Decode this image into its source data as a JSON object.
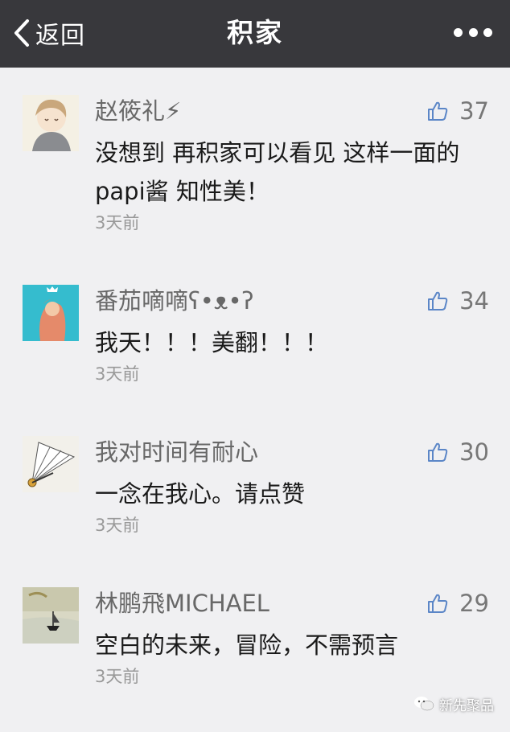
{
  "navbar": {
    "back_label": "返回",
    "title": "积家",
    "menu_icon": "more-dots-icon"
  },
  "comments": [
    {
      "name": "赵筱礼⚡",
      "likes": "37",
      "text": "没想到 再积家可以看见 这样一面的papi酱 知性美！",
      "time": "3天前"
    },
    {
      "name": "番茄嘀嘀ʕ•ᴥ•ʔ",
      "likes": "34",
      "text": "我天！！！美翻！！！",
      "time": "3天前"
    },
    {
      "name": "我对时间有耐心",
      "likes": "30",
      "text": "一念在我心。请点赞",
      "time": "3天前"
    },
    {
      "name": "林鹏飛MICHAEL",
      "likes": "29",
      "text": "空白的未来，冒险，不需预言",
      "time": "3天前"
    }
  ],
  "watermark": "新先聚品",
  "colors": {
    "navbar": "#38383c",
    "background": "#f0f0f2",
    "like_icon": "#5b86c7"
  }
}
